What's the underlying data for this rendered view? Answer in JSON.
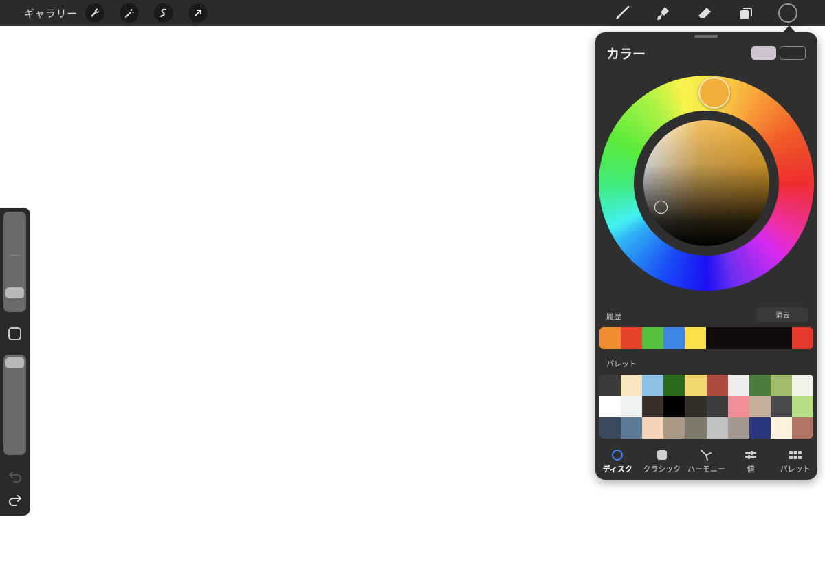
{
  "topbar": {
    "gallery_label": "ギャラリー",
    "left_tools": [
      "wrench-icon",
      "magic-wand-icon",
      "selection-icon",
      "move-arrow-icon"
    ],
    "right_tools": [
      "brush-icon",
      "smudge-icon",
      "eraser-icon",
      "layers-icon"
    ],
    "current_color": "#2b2b2b"
  },
  "color_panel": {
    "title": "カラー",
    "primary_swatch": "#cdc4cf",
    "secondary_swatch": "#2b2b2b",
    "hue_knob_color": "#f2ae3a",
    "history_label": "履歴",
    "clear_label": "消去",
    "history": [
      "#f18c31",
      "#e5432a",
      "#56c13c",
      "#3d86e6",
      "#fbe04b",
      "#110b0b",
      "#110b0b",
      "#110b0b",
      "#110b0b",
      "#e23a2c"
    ],
    "palette_label": "パレット",
    "palette": [
      "#3b3a38",
      "#f7e7c0",
      "#8fc1e6",
      "#2c6a1c",
      "#f0d66c",
      "#ad4b3e",
      "#eeeeee",
      "#4f7d3f",
      "#9ebc6c",
      "#f1f1ea",
      "#ffffff",
      "#eef1f2",
      "#3b2f2b",
      "#000000",
      "#333029",
      "#3c3c3c",
      "#ef8f9a",
      "#c4b09a",
      "#4a4a4d",
      "#b5de82",
      "#3a4a5d",
      "#5e7b95",
      "#f4d2b6",
      "#a79885",
      "#7f7a69",
      "#c1c1c1",
      "#a0968c",
      "#28377e",
      "#fbf1dd",
      "#b27266"
    ],
    "tabs": [
      {
        "label": "ディスク",
        "icon": "disc-icon",
        "active": true
      },
      {
        "label": "クラシック",
        "icon": "square-icon",
        "active": false
      },
      {
        "label": "ハーモニー",
        "icon": "harmony-icon",
        "active": false
      },
      {
        "label": "値",
        "icon": "sliders-icon",
        "active": false
      },
      {
        "label": "パレット",
        "icon": "grid-icon",
        "active": false
      }
    ]
  }
}
